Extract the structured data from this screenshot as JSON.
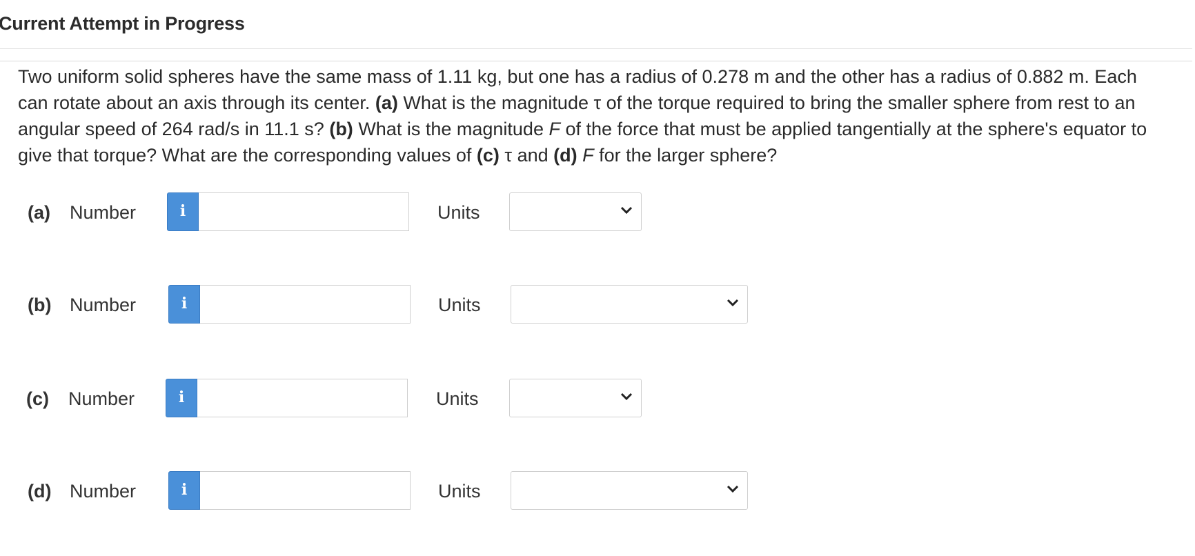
{
  "header": {
    "title": "Current Attempt in Progress"
  },
  "question": {
    "t1": "Two uniform solid spheres have the same mass of 1.11 kg, but one has a radius of 0.278 m and the other has a radius of 0.882 m. Each can rotate about an axis through its center. ",
    "a_tag": "(a)",
    "t2": " What is the magnitude τ of the torque required to bring the smaller sphere from rest to an angular speed of 264 rad/s in 11.1 s? ",
    "b_tag": "(b)",
    "t3": " What is the magnitude ",
    "F1": "F",
    "t4": " of the force that must be applied tangentially at the sphere's equator to give that torque? What are the corresponding values of ",
    "c_tag": "(c)",
    "t5": " τ and ",
    "d_tag": "(d)",
    "t6": " ",
    "F2": "F",
    "t7": " for the larger sphere?"
  },
  "parts": [
    {
      "label": "(a)",
      "number_label": "Number",
      "info": "i",
      "value": "",
      "units_label": "Units",
      "units_value": ""
    },
    {
      "label": "(b)",
      "number_label": "Number",
      "info": "i",
      "value": "",
      "units_label": "Units",
      "units_value": ""
    },
    {
      "label": "(c)",
      "number_label": "Number",
      "info": "i",
      "value": "",
      "units_label": "Units",
      "units_value": ""
    },
    {
      "label": "(d)",
      "number_label": "Number",
      "info": "i",
      "value": "",
      "units_label": "Units",
      "units_value": ""
    }
  ],
  "colors": {
    "info_button": "#4a90d9",
    "border": "#cfcfcf"
  }
}
